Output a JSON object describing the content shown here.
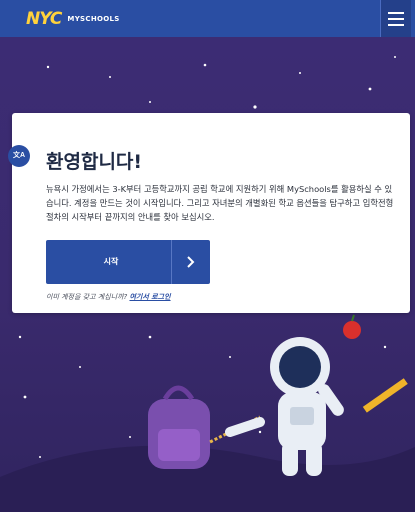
{
  "header": {
    "logo_nyc": "NYC",
    "logo_myschools": "MYSCHOOLS",
    "menu_icon": "hamburger-icon"
  },
  "card": {
    "translate_badge": "文A",
    "title": "환영합니다!",
    "body": "뉴욕시 가정에서는 3-K부터 고등학교까지 공립 학교에 지원하기 위해 MySchools를 활용하실 수 있습니다. 계정을 만드는 것이 시작입니다. 그리고 자녀분의 개별화된 학교 옵션들을 탐구하고 입학전형 절차의 시작부터 끝까지의 안내를 찾아 보십시오.",
    "start_button": "시작",
    "login_prompt": "이미 계정을 갖고 계십니까?",
    "login_link": "여기서 로그인"
  },
  "colors": {
    "header_bg": "#2a4ea3",
    "logo_yellow": "#ffd23c",
    "sky": "#3b2a6e",
    "button": "#2a4ea3"
  }
}
